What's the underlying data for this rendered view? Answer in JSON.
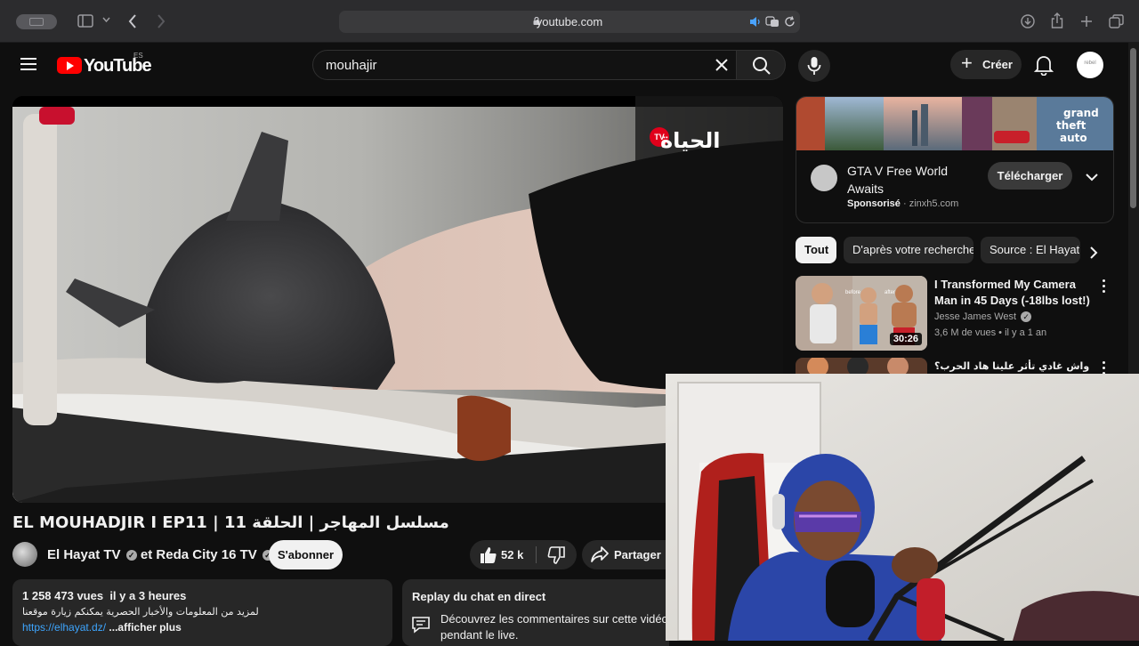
{
  "browser": {
    "url": "youtube.com"
  },
  "header": {
    "logo_text": "YouTube",
    "logo_country": "ES",
    "search_value": "mouhajir",
    "create_label": "Créer",
    "avatar_text": "rebel"
  },
  "video": {
    "watermark_text": "الحياة",
    "watermark_badge": "TV",
    "title": "EL MOUHADJIR I EP11 | مسلسل المهاجر | الحلقة 11",
    "channel": "El Hayat TV",
    "channel_joiner": "et",
    "channel2": "Reda City 16 TV",
    "subscribe_label": "S'abonner",
    "likes": "52 k",
    "share_label": "Partager",
    "views": "1 258 473 vues",
    "published": "il y a 3 heures",
    "description": "لمزيد من المعلومات والأخبار الحصرية يمكنكم زيارة موقعنا",
    "description_link": "https://elhayat.dz/",
    "description_more": "...afficher plus",
    "chat_title": "Replay du chat en direct",
    "chat_message": "Découvrez les commentaires sur cette vidéo pendant le live."
  },
  "ad": {
    "title": "GTA V Free World Awaits",
    "sponsored_label": "Sponsorisé",
    "domain": "zinxh5.com",
    "cta_label": "Télécharger",
    "banner_text": "grand theft auto"
  },
  "chips": [
    {
      "label": "Tout",
      "active": true
    },
    {
      "label": "D'après votre recherche",
      "active": false
    },
    {
      "label": "Source : El Hayat",
      "active": false
    }
  ],
  "recommendations": [
    {
      "title": "I Transformed My Camera Man in 45 Days (-18lbs lost!)",
      "channel": "Jesse James West",
      "views": "3,6 M de vues",
      "age": "il y a 1 an",
      "duration": "30:26",
      "thumb_before": "before",
      "thumb_after": "after"
    },
    {
      "title": "واش غادي تأثر علينا هاد الحرب؟",
      "channel": "",
      "views": "",
      "age": "",
      "duration": ""
    }
  ],
  "colors": {
    "youtube_red": "#ff0000",
    "background": "#0f0f0f",
    "link": "#3ea6ff",
    "chip_bg": "#272727"
  },
  "icons": [
    "menu-icon",
    "search-icon",
    "mic-icon",
    "plus-icon",
    "bell-icon",
    "like-icon",
    "dislike-icon",
    "share-icon",
    "chat-icon",
    "chevron-down-icon",
    "chevron-right-icon",
    "more-vert-icon",
    "lock-icon",
    "sidebar-icon",
    "back-icon",
    "forward-icon",
    "download-icon",
    "share-sheet-icon",
    "new-tab-icon",
    "tabs-icon",
    "speaker-icon",
    "translate-icon",
    "reload-icon",
    "verified-icon"
  ]
}
